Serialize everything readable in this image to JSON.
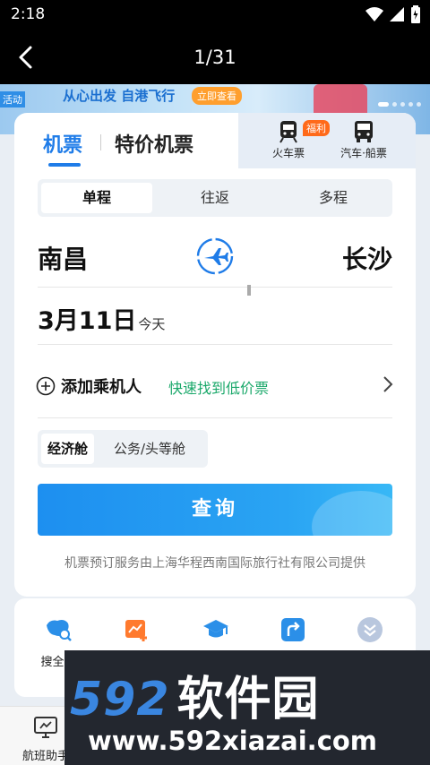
{
  "status_bar": {
    "time": "2:18"
  },
  "viewer": {
    "page_counter": "1/31"
  },
  "banner": {
    "tag": "活动",
    "text": "从心出发 自港飞行",
    "cta": "立即查看"
  },
  "tabs": {
    "flights": "机票",
    "special": "特价机票",
    "train": "火车票",
    "train_badge": "福利",
    "bus_ship": "汽车·船票"
  },
  "trip_types": {
    "one_way": "单程",
    "round_trip": "往返",
    "multi": "多程"
  },
  "route": {
    "from": "南昌",
    "to": "长沙"
  },
  "date": {
    "main": "3月11日",
    "sub": "今天"
  },
  "passenger": {
    "label": "添加乘机人",
    "link": "快速找到低价票"
  },
  "cabins": {
    "economy": "经济舱",
    "business": "公务/头等舱"
  },
  "search": {
    "label": "查询"
  },
  "provider_note": "机票预订服务由上海华程西南国际旅行社有限公司提供",
  "services": [
    {
      "label": "搜全国",
      "icon": "china-map-search-icon"
    },
    {
      "label": "",
      "icon": "price-trend-icon"
    },
    {
      "label": "",
      "icon": "student-cap-icon"
    },
    {
      "label": "",
      "icon": "route-arrow-icon"
    },
    {
      "label": "",
      "icon": "expand-more-icon"
    }
  ],
  "bottom_nav": {
    "label": "航班助手",
    "icon": "monitor-icon"
  },
  "watermark": {
    "brand_num": "592",
    "brand_cn": "软件园",
    "url": "www.592xiazai.com"
  },
  "colors": {
    "accent": "#1f7ce8",
    "green": "#1aa86a",
    "badge": "#ff6a1a"
  }
}
